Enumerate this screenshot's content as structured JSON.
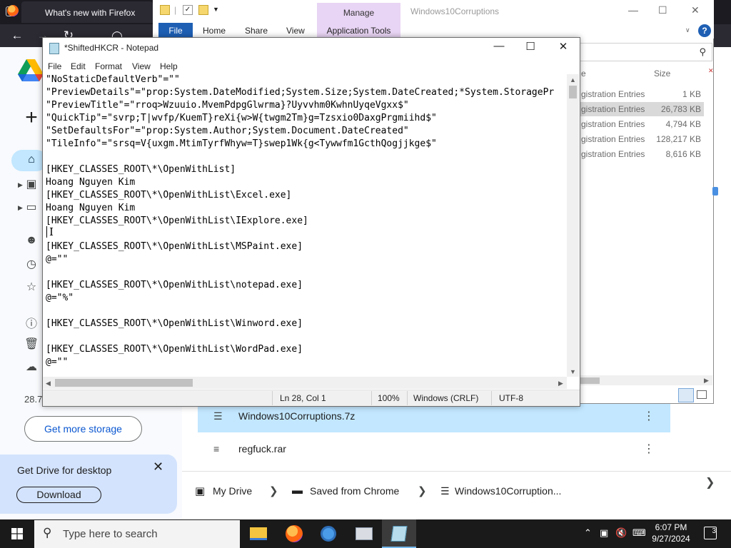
{
  "firefox": {
    "tab_title": "What's new with Firefox"
  },
  "drive": {
    "storage_text": "28.7",
    "more_storage_label": "Get more storage",
    "promo_title": "Get Drive for desktop",
    "promo_download": "Download",
    "files": [
      {
        "name": "Windows10Corruptions.7z",
        "selected": true
      },
      {
        "name": "regfuck.rar",
        "selected": false
      }
    ],
    "breadcrumb": [
      "My Drive",
      "Saved from Chrome",
      "Windows10Corruption..."
    ]
  },
  "explorer": {
    "manage_label": "Manage",
    "window_title": "Windows10Corruptions",
    "tabs": [
      "File",
      "Home",
      "Share",
      "View",
      "Application Tools"
    ],
    "column_size": "Size",
    "rows": [
      {
        "type": "gistration Entries",
        "size": "1 KB"
      },
      {
        "type": "gistration Entries",
        "size": "26,783 KB"
      },
      {
        "type": "gistration Entries",
        "size": "4,794 KB"
      },
      {
        "type": "gistration Entries",
        "size": "128,217 KB"
      },
      {
        "type": "gistration Entries",
        "size": "8,616 KB"
      }
    ]
  },
  "notepad": {
    "title": "*ShiftedHKCR - Notepad",
    "menu": [
      "File",
      "Edit",
      "Format",
      "View",
      "Help"
    ],
    "lines": [
      "\"NoStaticDefaultVerb\"=\"\"",
      "\"PreviewDetails\"=\"prop:System.DateModified;System.Size;System.DateCreated;*System.StoragePr",
      "\"PreviewTitle\"=\"rroq>Wzuuio.MvemPdpgGlwrma}?Uyvvhm0KwhnUyqeVgxx$\"",
      "\"QuickTip\"=\"svrp;T|wvfp/KuemT}reXi{w>W{twgm2Tm}g=Tzsxio0DaxgPrgmiihd$\"",
      "\"SetDefaultsFor\"=\"prop:System.Author;System.Document.DateCreated\"",
      "\"TileInfo\"=\"srsq=V{uxgm.MtimTyrfWhyw=T}swep1Wk{g<Tywwfm1GcthQogjjkge$\"",
      "",
      "[HKEY_CLASSES_ROOT\\*\\OpenWithList]",
      "Hoang Nguyen Kim",
      "[HKEY_CLASSES_ROOT\\*\\OpenWithList\\Excel.exe]",
      "Hoang Nguyen Kim",
      "[HKEY_CLASSES_ROOT\\*\\OpenWithList\\IExplore.exe]",
      "",
      "[HKEY_CLASSES_ROOT\\*\\OpenWithList\\MSPaint.exe]",
      "@=\"\"",
      "",
      "[HKEY_CLASSES_ROOT\\*\\OpenWithList\\notepad.exe]",
      "@=\"%\"",
      "",
      "[HKEY_CLASSES_ROOT\\*\\OpenWithList\\Winword.exe]",
      "",
      "[HKEY_CLASSES_ROOT\\*\\OpenWithList\\WordPad.exe]",
      "@=\"\""
    ],
    "status": {
      "position": "Ln 28, Col 1",
      "zoom": "100%",
      "line_ending": "Windows (CRLF)",
      "encoding": "UTF-8"
    }
  },
  "taskbar": {
    "search_placeholder": "Type here to search",
    "time": "6:07 PM",
    "date": "9/27/2024",
    "notification_count": "3"
  },
  "colors": {
    "drive_selected_row": "#c2e7ff",
    "manage_tab": "#e8d4f4",
    "explorer_file_tab": "#1e5fb4",
    "taskbar": "#1a1a1a"
  }
}
